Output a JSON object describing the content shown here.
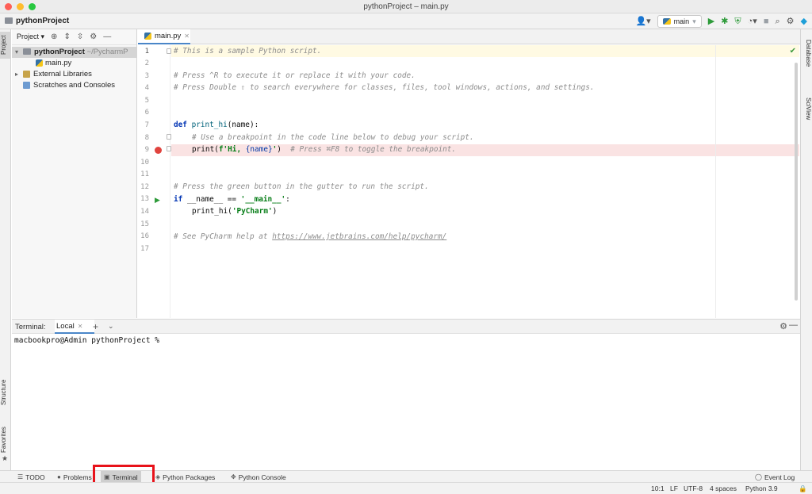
{
  "window": {
    "title": "pythonProject – main.py"
  },
  "navbar": {
    "project": "pythonProject",
    "run_config": "main"
  },
  "left_strip": {
    "project": "Project",
    "structure": "Structure",
    "favorites": "Favorites"
  },
  "right_strip": {
    "database": "Database",
    "sciview": "SciView"
  },
  "project_panel": {
    "title": "Project",
    "tree": {
      "root_name": "pythonProject",
      "root_path": "~/PycharmP",
      "file": "main.py",
      "external": "External Libraries",
      "scratches": "Scratches and Consoles"
    }
  },
  "editor": {
    "tab_label": "main.py",
    "line_numbers": [
      "1",
      "2",
      "3",
      "4",
      "5",
      "6",
      "7",
      "8",
      "9",
      "10",
      "11",
      "12",
      "13",
      "14",
      "15",
      "16",
      "17"
    ],
    "code": {
      "l1": "# This is a sample Python script.",
      "l3": "# Press ^R to execute it or replace it with your code.",
      "l4": "# Press Double ⇧ to search everywhere for classes, files, tool windows, actions, and settings.",
      "l7_kw": "def ",
      "l7_fn": "print_hi",
      "l7_rest": "(name):",
      "l8": "# Use a breakpoint in the code line below to debug your script.",
      "l9_a": "print(",
      "l9_str": "f'Hi, ",
      "l9_b": "{name}",
      "l9_str2": "'",
      "l9_c": ")  ",
      "l9_cmt": "# Press ⌘F8 to toggle the breakpoint.",
      "l12": "# Press the green button in the gutter to run the script.",
      "l13_kw": "if ",
      "l13_mid": "__name__ == ",
      "l13_str": "'__main__'",
      "l13_end": ":",
      "l14_a": "print_hi(",
      "l14_str": "'PyCharm'",
      "l14_b": ")",
      "l16_cmt": "# See PyCharm help at ",
      "l16_link": "https://www.jetbrains.com/help/pycharm/"
    }
  },
  "terminal": {
    "title": "Terminal:",
    "tab": "Local",
    "prompt": "macbookpro@Admin pythonProject %"
  },
  "bottom_bar": {
    "todo": "TODO",
    "problems": "Problems",
    "terminal": "Terminal",
    "packages": "Python Packages",
    "console": "Python Console",
    "event_log": "Event Log"
  },
  "status": {
    "position": "10:1",
    "line_sep": "LF",
    "encoding": "UTF-8",
    "indent": "4 spaces",
    "interpreter": "Python 3.9"
  },
  "colors": {
    "highlight_box": "#e8121a",
    "accent": "#4a86c8"
  }
}
